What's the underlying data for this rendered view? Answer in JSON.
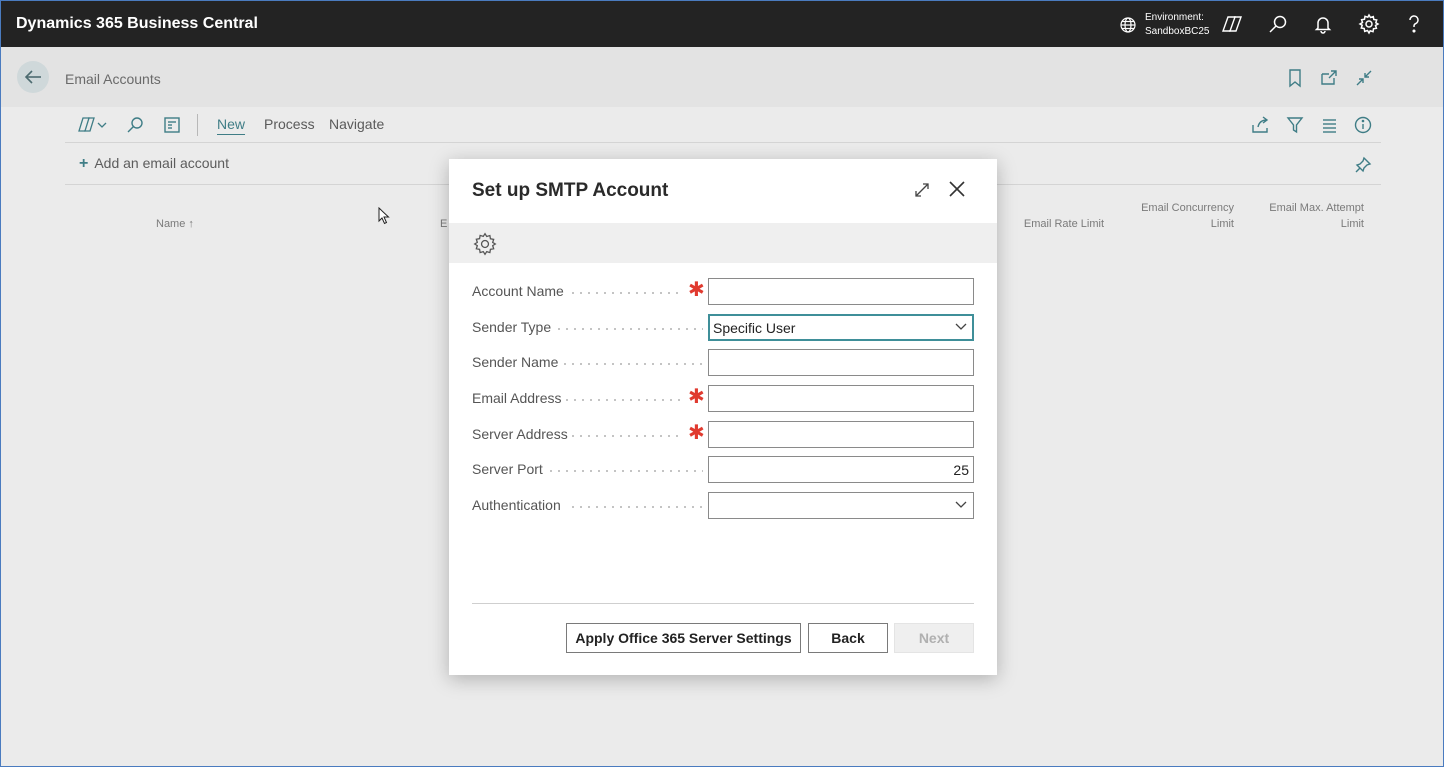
{
  "app": {
    "title": "Dynamics 365 Business Central"
  },
  "topbar": {
    "environment_label": "Environment:",
    "environment_value": "SandboxBC25",
    "icons": [
      "globe-icon",
      "copilot-icon",
      "search-icon",
      "bell-icon",
      "gear-icon",
      "help-icon"
    ]
  },
  "page": {
    "title": "Email Accounts",
    "actions": {
      "new": "New",
      "process": "Process",
      "navigate": "Navigate"
    },
    "add_account": "Add an email account",
    "columns": {
      "name": "Name ↑",
      "email_partial": "E",
      "rate_limit": "Email Rate Limit",
      "concurrency_l1": "Email Concurrency",
      "concurrency_l2": "Limit",
      "max_attempt_l1": "Email Max. Attempt",
      "max_attempt_l2": "Limit"
    }
  },
  "dialog": {
    "title": "Set up SMTP Account",
    "fields": {
      "account_name": {
        "label": "Account Name",
        "value": "",
        "required": true
      },
      "sender_type": {
        "label": "Sender Type",
        "value": "Specific User"
      },
      "sender_name": {
        "label": "Sender Name",
        "value": ""
      },
      "email_address": {
        "label": "Email Address",
        "value": "",
        "required": true
      },
      "server_address": {
        "label": "Server Address",
        "value": "",
        "required": true
      },
      "server_port": {
        "label": "Server Port",
        "value": "25"
      },
      "authentication": {
        "label": "Authentication",
        "value": ""
      }
    },
    "required_mark": "✱",
    "buttons": {
      "apply": "Apply Office 365 Server Settings",
      "back": "Back",
      "next": "Next"
    }
  },
  "colors": {
    "accent": "#3f7d86",
    "required": "#e03a2f",
    "topbar": "#232323"
  }
}
